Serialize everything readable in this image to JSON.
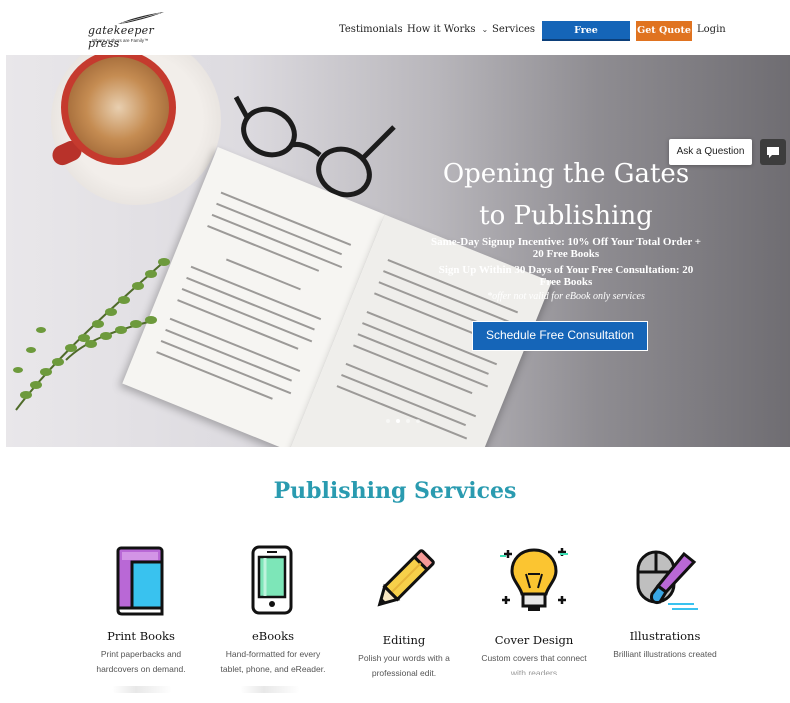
{
  "logo": {
    "name": "gatekeeper press",
    "tagline": "Where Authors are Family™"
  },
  "nav": {
    "items": [
      {
        "label": "Testimonials",
        "dropdown": false
      },
      {
        "label": "How it Works",
        "dropdown": true
      },
      {
        "label": "Services",
        "dropdown": true
      }
    ],
    "free_consultation": "Free Consultation",
    "get_quote": "Get Quote",
    "login": "Login"
  },
  "colors": {
    "primary_blue": "#1565b8",
    "orange": "#e07320",
    "teal": "#2a9bb0"
  },
  "hero": {
    "title_line1": "Opening the Gates",
    "title_line2": "to Publishing",
    "incentive_line1": "Same-Day Signup Incentive: 10% Off Your Total Order +",
    "incentive_line2": "20 Free Books",
    "signup_line1": "Sign Up Within 30 Days of Your Free Consultation: 20",
    "signup_line2": "Free Books",
    "note": "*offer not valid for eBook only services",
    "cta": "Schedule Free Consultation",
    "slides": 4,
    "active_slide": 2
  },
  "chat": {
    "ask": "Ask a Question",
    "icon": "chat-icon"
  },
  "services": {
    "title": "Publishing Services",
    "items": [
      {
        "icon": "book-icon",
        "title": "Print Books",
        "desc1": "Print paperbacks and",
        "desc2": "hardcovers on demand."
      },
      {
        "icon": "phone-icon",
        "title": "eBooks",
        "desc1": "Hand-formatted for every",
        "desc2": "tablet, phone, and eReader."
      },
      {
        "icon": "pencil-icon",
        "title": "Editing",
        "desc1": "Polish your words with a",
        "desc2": "professional edit."
      },
      {
        "icon": "lightbulb-icon",
        "title": "Cover Design",
        "desc1": "Custom covers that connect",
        "desc2": "with readers"
      },
      {
        "icon": "paint-mouse-icon",
        "title": "Illustrations",
        "desc1": "Brilliant illustrations created",
        "desc2": ""
      }
    ]
  }
}
